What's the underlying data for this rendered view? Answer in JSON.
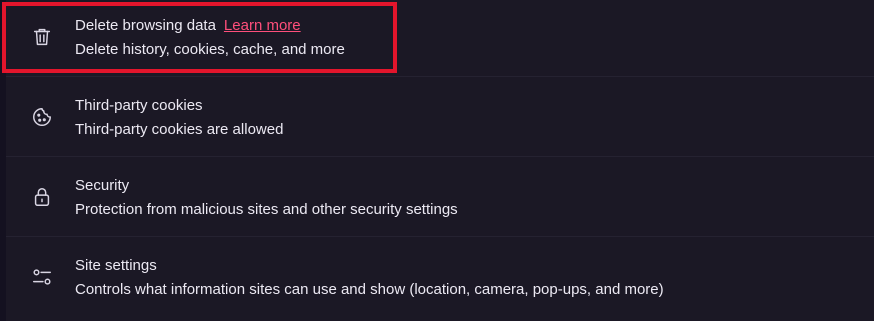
{
  "settings": {
    "items": [
      {
        "title": "Delete browsing data",
        "link": "Learn more",
        "subtitle": "Delete history, cookies, cache, and more",
        "icon": "trash-icon"
      },
      {
        "title": "Third-party cookies",
        "subtitle": "Third-party cookies are allowed",
        "icon": "cookie-icon"
      },
      {
        "title": "Security",
        "subtitle": "Protection from malicious sites and other security settings",
        "icon": "lock-icon"
      },
      {
        "title": "Site settings",
        "subtitle": "Controls what information sites can use and show (location, camera, pop-ups, and more)",
        "icon": "sliders-icon"
      }
    ]
  },
  "colors": {
    "background": "#1b1825",
    "text": "#ece9f3",
    "link": "#ff4f7b",
    "highlight_border": "#e3152c"
  }
}
